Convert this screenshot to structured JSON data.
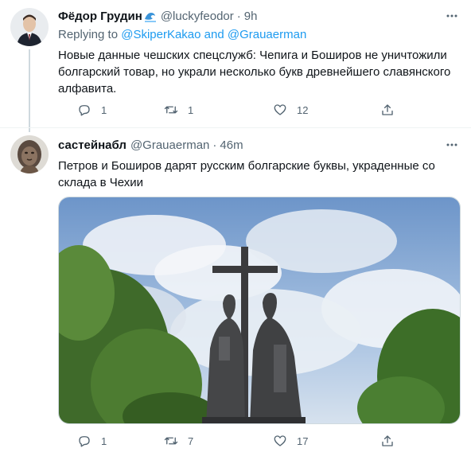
{
  "tweets": [
    {
      "name": "Фёдор Грудин",
      "handle": "@luckyfeodor",
      "separator": "·",
      "time": "9h",
      "replying_prefix": "Replying to",
      "replying_to": "@SkiperKakao and @Grauaerman",
      "text": "Новые данные чешских спецслужб: Чепига и Боширов не уничтожили болгарский товар, но украли несколько букв древнейшего славянского алфавита.",
      "replies": "1",
      "retweets": "1",
      "likes": "12",
      "name_emoji_icon": "wave-icon"
    },
    {
      "name": "састейнабл",
      "handle": "@Grauaerman",
      "separator": "·",
      "time": "46m",
      "text": "Петров и Боширов дарят русским болгарские буквы, украденные со склада в Чехии",
      "replies": "1",
      "retweets": "7",
      "likes": "17",
      "media_subject": "monument-photo"
    }
  ],
  "colors": {
    "text": "#0f1419",
    "secondary": "#536471",
    "link": "#1d9bf0",
    "thread_line": "#cfd9de"
  }
}
